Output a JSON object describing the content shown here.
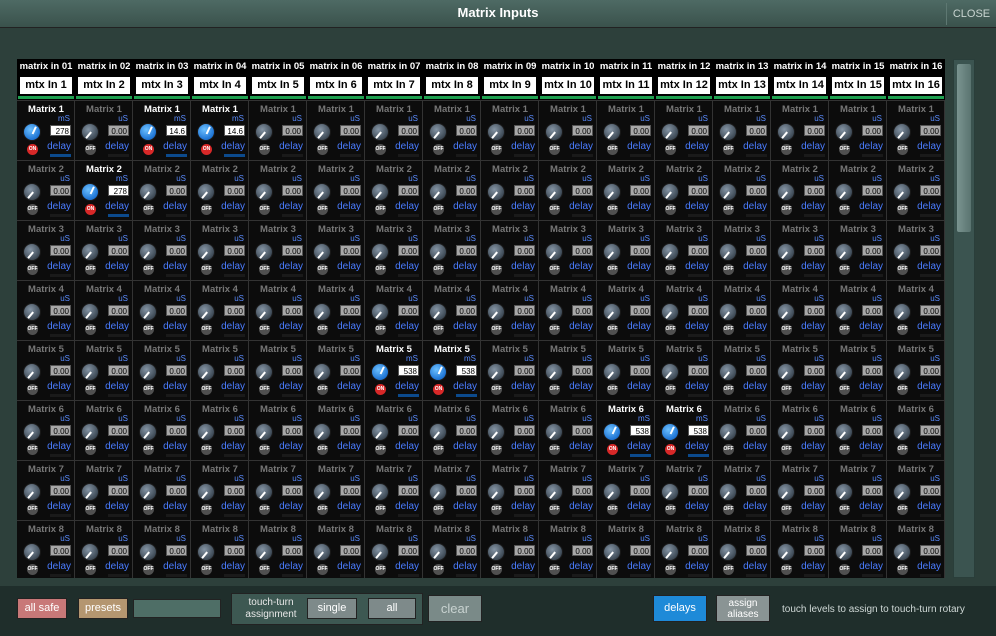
{
  "window": {
    "title": "Matrix Inputs",
    "close_label": "CLOSE"
  },
  "columns": [
    {
      "title": "matrix in 01",
      "alias": "mtx In 1"
    },
    {
      "title": "matrix in 02",
      "alias": "mtx In 2"
    },
    {
      "title": "matrix in 03",
      "alias": "mtx In 3"
    },
    {
      "title": "matrix in 04",
      "alias": "mtx In 4"
    },
    {
      "title": "matrix in 05",
      "alias": "mtx In 5"
    },
    {
      "title": "matrix in 06",
      "alias": "mtx In 6"
    },
    {
      "title": "matrix in 07",
      "alias": "mtx In 7"
    },
    {
      "title": "matrix in 08",
      "alias": "mtx In 8"
    },
    {
      "title": "matrix in 09",
      "alias": "mtx In 9"
    },
    {
      "title": "matrix in 10",
      "alias": "mtx In 10"
    },
    {
      "title": "matrix in 11",
      "alias": "mtx In 11"
    },
    {
      "title": "matrix in 12",
      "alias": "mtx In 12"
    },
    {
      "title": "matrix in 13",
      "alias": "mtx In 13"
    },
    {
      "title": "matrix in 14",
      "alias": "mtx In 14"
    },
    {
      "title": "matrix in 15",
      "alias": "mtx In 15"
    },
    {
      "title": "matrix in 16",
      "alias": "mtx In 16"
    }
  ],
  "rows": [
    "Matrix 1",
    "Matrix 2",
    "Matrix 3",
    "Matrix 4",
    "Matrix 5",
    "Matrix 6",
    "Matrix 7",
    "Matrix 8"
  ],
  "cell_defaults": {
    "value": "0.00",
    "unit": "uS",
    "state": "OFF",
    "delay_label": "delay"
  },
  "active_cells": [
    {
      "row": 0,
      "col": 0,
      "value": "278",
      "unit": "mS",
      "state": "ON"
    },
    {
      "row": 0,
      "col": 2,
      "value": "14.6",
      "unit": "mS",
      "state": "ON"
    },
    {
      "row": 0,
      "col": 3,
      "value": "14.6",
      "unit": "mS",
      "state": "ON"
    },
    {
      "row": 1,
      "col": 1,
      "value": "278",
      "unit": "mS",
      "state": "ON"
    },
    {
      "row": 4,
      "col": 6,
      "value": "538",
      "unit": "mS",
      "state": "ON"
    },
    {
      "row": 4,
      "col": 7,
      "value": "538",
      "unit": "mS",
      "state": "ON"
    },
    {
      "row": 5,
      "col": 10,
      "value": "538",
      "unit": "mS",
      "state": "ON"
    },
    {
      "row": 5,
      "col": 11,
      "value": "538",
      "unit": "mS",
      "state": "ON"
    }
  ],
  "bottom": {
    "all_safe": "all safe",
    "presets": "presets",
    "touch_turn_label": "touch-turn assignment",
    "single": "single",
    "all": "all",
    "clear": "clear",
    "delays": "delays",
    "assign_aliases": "assign aliases",
    "hint": "touch levels to assign to touch-turn rotary"
  },
  "colors": {
    "accent": "#1e8ad8",
    "on": "#d82828",
    "header_bar": "#1fa050",
    "panel": "#2d403b"
  },
  "icons": {
    "corner": "tools-icon"
  }
}
